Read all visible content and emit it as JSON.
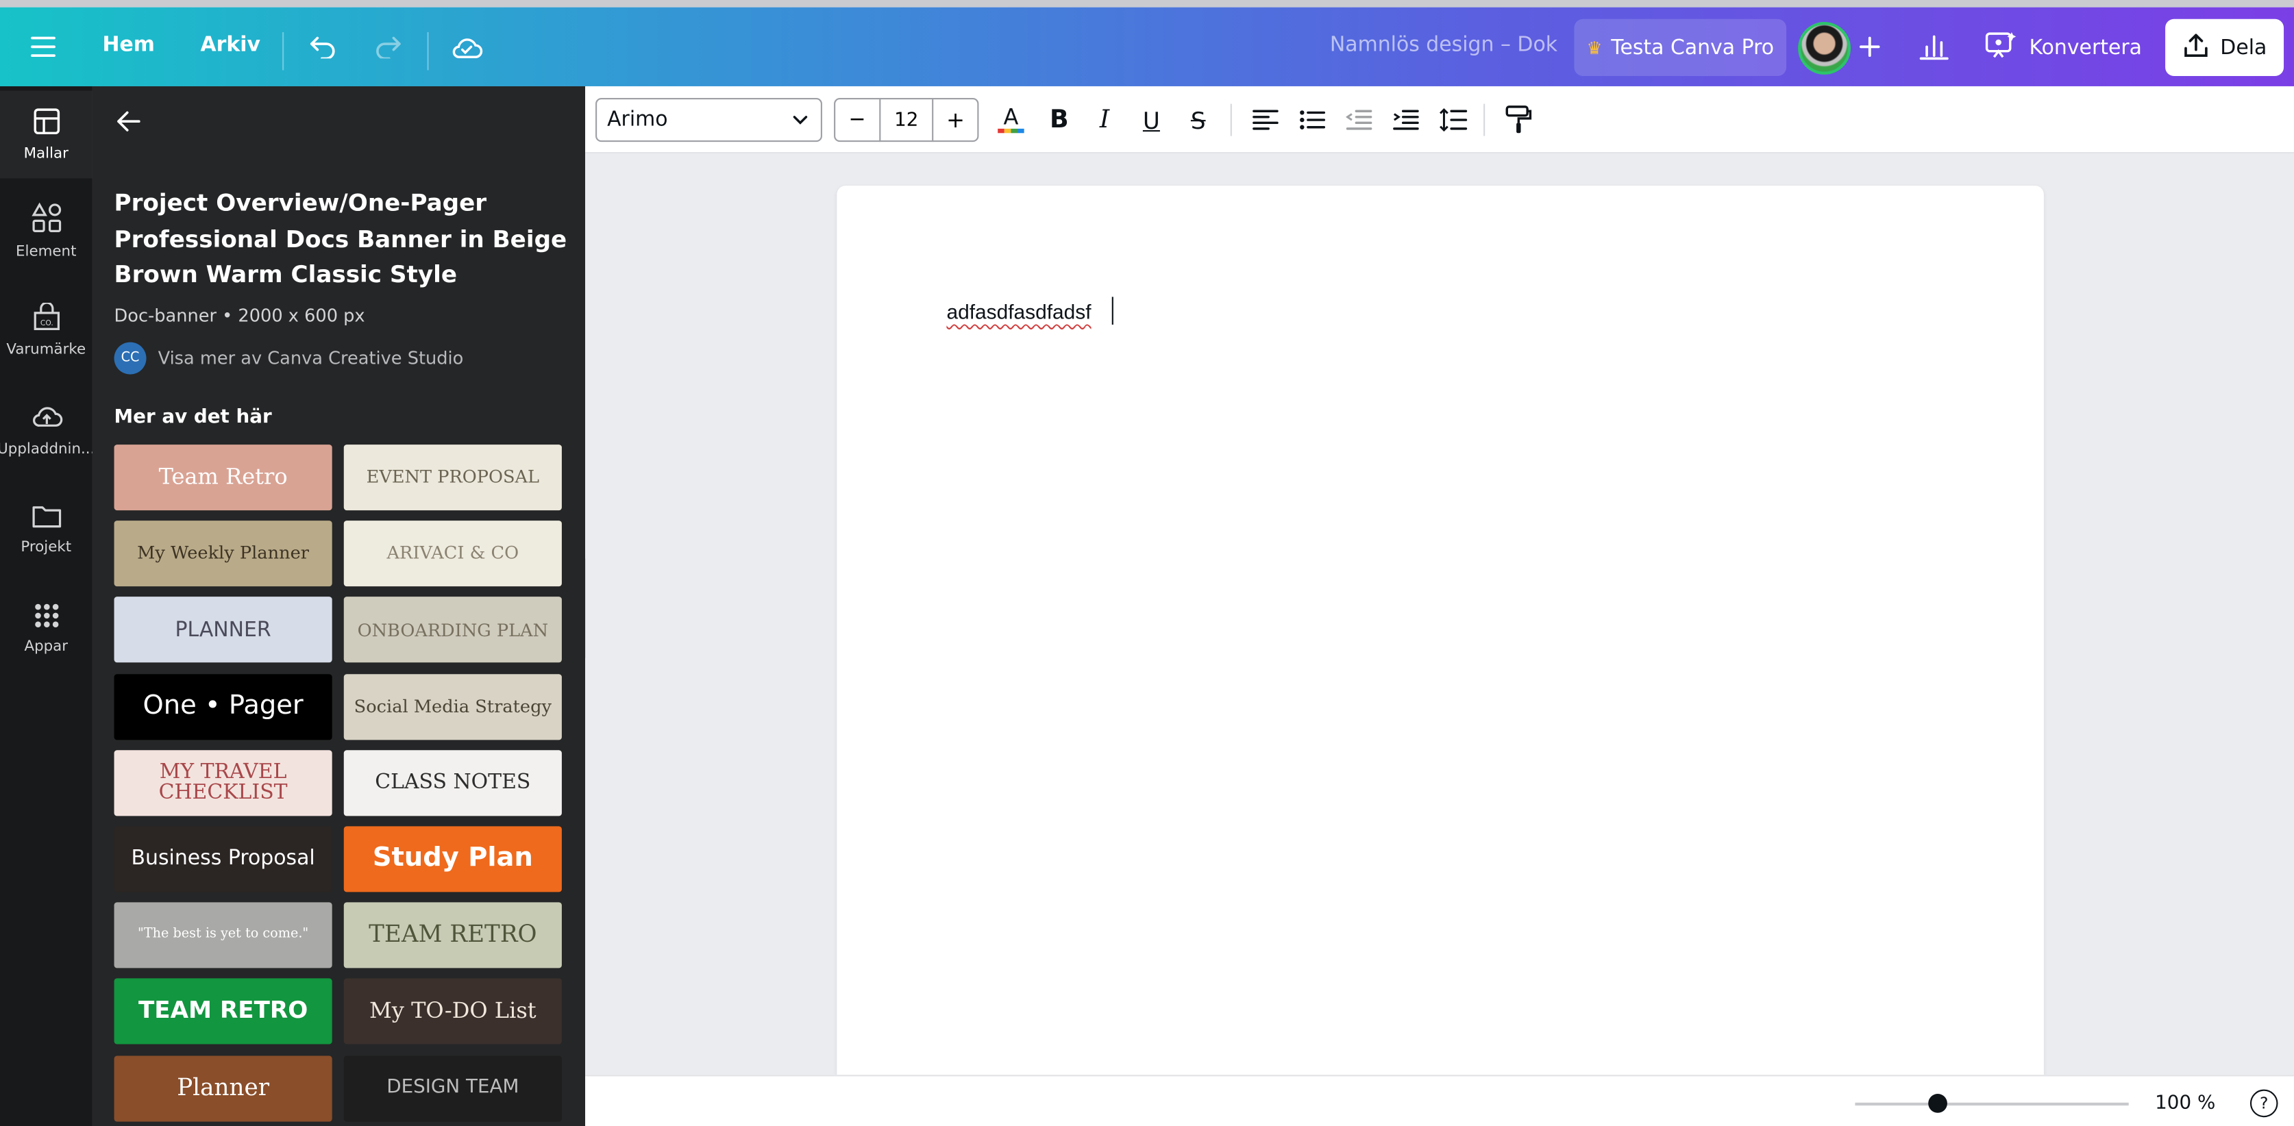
{
  "header": {
    "home": "Hem",
    "file": "Arkiv",
    "doc_title": "Namnlös design – Dok",
    "try_pro": "Testa Canva Pro",
    "convert": "Konvertera",
    "share": "Dela"
  },
  "rail": [
    {
      "label": "Mallar",
      "icon": "templates-icon"
    },
    {
      "label": "Element",
      "icon": "elements-icon"
    },
    {
      "label": "Varumärke",
      "icon": "brand-icon"
    },
    {
      "label": "Uppladdnin...",
      "icon": "upload-icon"
    },
    {
      "label": "Projekt",
      "icon": "folder-icon"
    },
    {
      "label": "Appar",
      "icon": "apps-icon"
    }
  ],
  "panel": {
    "title": "Project Overview/One-Pager Professional Docs Banner in Beige Brown Warm Classic Style",
    "meta": "Doc-banner • 2000 x 600 px",
    "creator_initials": "CC",
    "creator_link": "Visa mer av Canva Creative Studio",
    "more_heading": "Mer av det här",
    "templates": [
      {
        "text": "Team Retro",
        "bg": "#d9a394",
        "fg": "#ffffff"
      },
      {
        "text": "EVENT PROPOSAL",
        "bg": "#ece9dc",
        "fg": "#6b6453"
      },
      {
        "text": "My Weekly Planner",
        "bg": "#b9ab89",
        "fg": "#3d3324"
      },
      {
        "text": "ARIVACI & CO",
        "bg": "#eeebdf",
        "fg": "#8a8271"
      },
      {
        "text": "PLANNER",
        "bg": "#d6dce8",
        "fg": "#4a4a5a"
      },
      {
        "text": "ONBOARDING PLAN",
        "bg": "#cfcbbd",
        "fg": "#77705f"
      },
      {
        "text": "One • Pager",
        "bg": "#000000",
        "fg": "#ffffff"
      },
      {
        "text": "Social Media Strategy",
        "bg": "#d8d3c5",
        "fg": "#4b4536"
      },
      {
        "text": "MY TRAVEL CHECKLIST",
        "bg": "#f3e3de",
        "fg": "#a8474a"
      },
      {
        "text": "CLASS NOTES",
        "bg": "#f2f1ef",
        "fg": "#2d2d2d"
      },
      {
        "text": "Business Proposal",
        "bg": "#2b2523",
        "fg": "#ffffff"
      },
      {
        "text": "Study Plan",
        "bg": "#ef6a1c",
        "fg": "#ffffff"
      },
      {
        "text": "\"The best is yet to come.\"",
        "bg": "#a9a9a7",
        "fg": "#ffffff"
      },
      {
        "text": "TEAM RETRO",
        "bg": "#c7cbb4",
        "fg": "#4f553a"
      },
      {
        "text": "TEAM RETRO",
        "bg": "#12963f",
        "fg": "#ffffff"
      },
      {
        "text": "My TO-DO List",
        "bg": "#3b302c",
        "fg": "#f1e7dc"
      },
      {
        "text": "Planner",
        "bg": "#8a4e2a",
        "fg": "#ffffff"
      },
      {
        "text": "DESIGN TEAM",
        "bg": "#1e1e1e",
        "fg": "#bdbdbd"
      }
    ]
  },
  "toolbar": {
    "font": "Arimo",
    "size": "12",
    "minus": "−",
    "plus": "+"
  },
  "doc": {
    "text": "adfasdfasdfadsf"
  },
  "footer": {
    "zoom": "100 %",
    "help": "?"
  },
  "colors": {
    "accent_gradient_start": "#17c2c8",
    "accent_gradient_end": "#7b3fe6",
    "sidebar_bg": "#18191b",
    "panel_bg": "#252627"
  }
}
